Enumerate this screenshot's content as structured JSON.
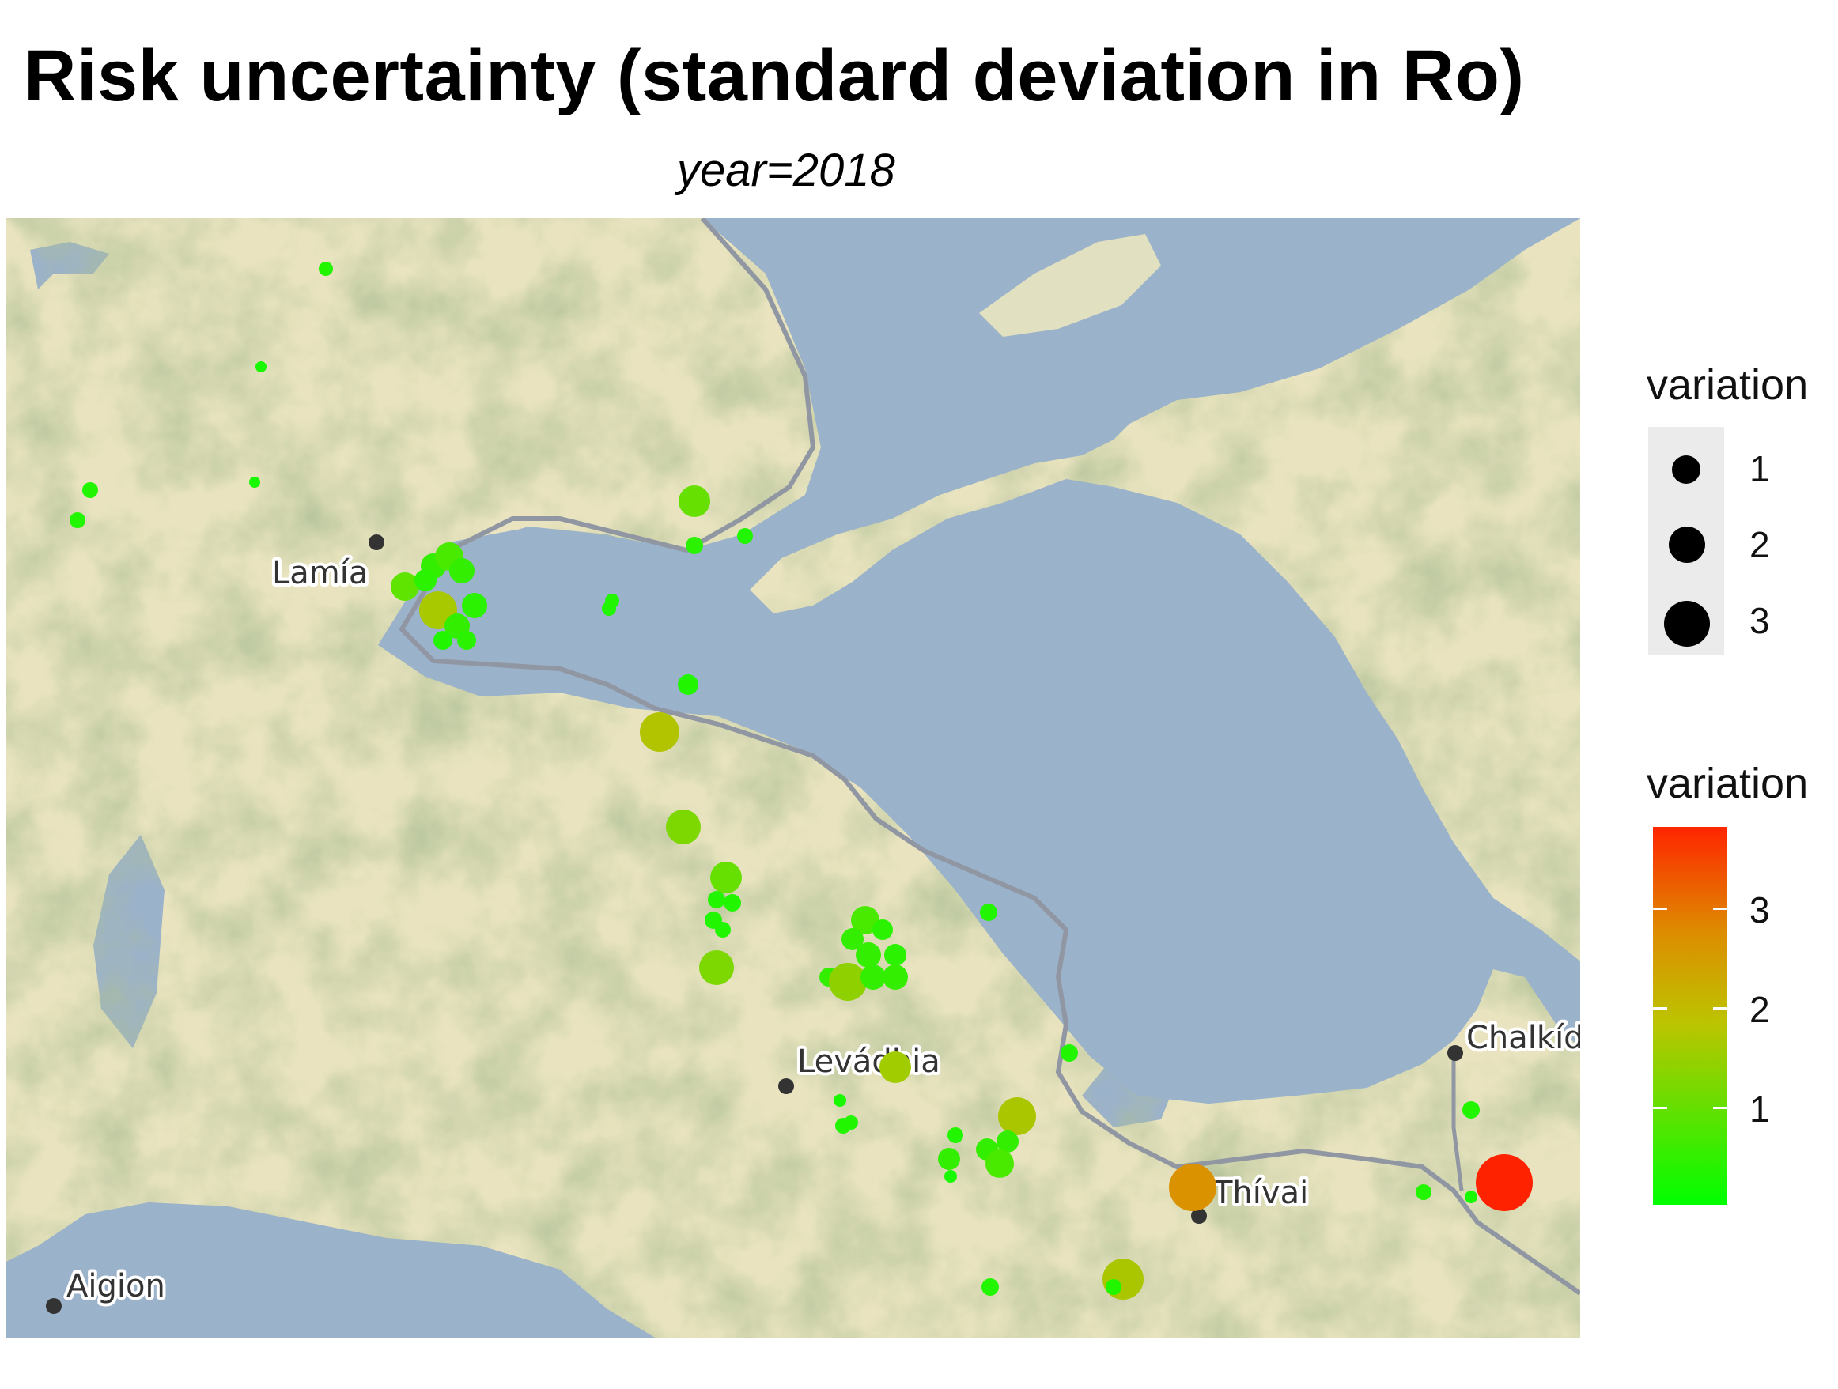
{
  "title": "Risk uncertainty (standard deviation in Ro)",
  "subtitle": "year=2018",
  "map": {
    "places": [
      {
        "name": "Lamía"
      },
      {
        "name": "Levádhia"
      },
      {
        "name": "Chalkída"
      },
      {
        "name": "Thívai"
      },
      {
        "name": "Aigion"
      }
    ],
    "colors": {
      "sea": "#9bb2cb",
      "land": "#e9e4bf",
      "hills": "#a9bb8c",
      "road": "#9097a3"
    }
  },
  "legend": {
    "size": {
      "title": "variation",
      "items": [
        {
          "label": "1",
          "value": 1
        },
        {
          "label": "2",
          "value": 2
        },
        {
          "label": "3",
          "value": 3
        }
      ]
    },
    "color": {
      "title": "variation",
      "ticks": [
        {
          "label": "1",
          "value": 1
        },
        {
          "label": "2",
          "value": 2
        },
        {
          "label": "3",
          "value": 3
        }
      ],
      "range": [
        0,
        3.9
      ],
      "low_color": "#00ff00",
      "high_color": "#ff2500"
    }
  }
}
